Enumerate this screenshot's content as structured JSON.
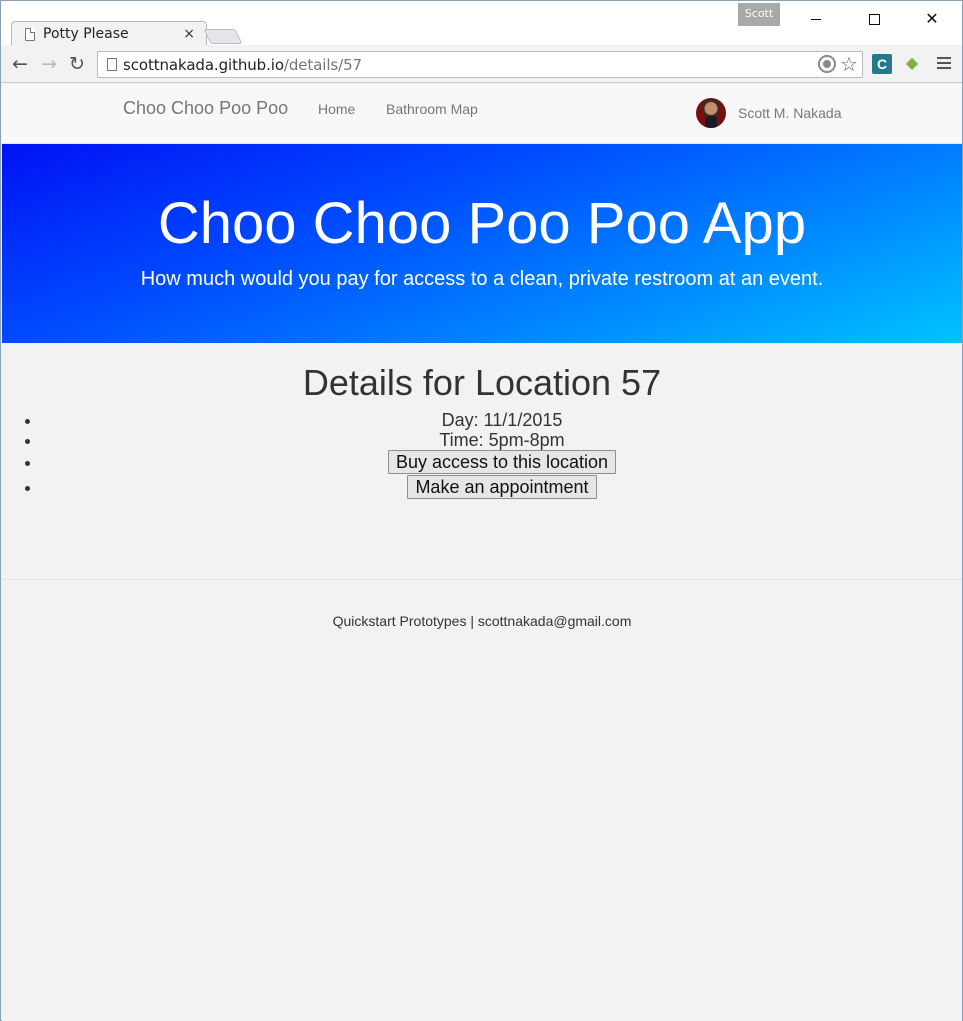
{
  "browser": {
    "tab_title": "Potty Please",
    "tab_close": "×",
    "profile_name": "Scott",
    "url_host": "scottnakada.github.io",
    "url_path": "/details/57",
    "back_icon": "←",
    "forward_icon": "→",
    "reload_icon": "↻",
    "star_icon": "☆",
    "close_icon": "✕",
    "ext1_label": "C",
    "ext2_label": "◆"
  },
  "navbar": {
    "brand": "Choo Choo Poo Poo",
    "links": [
      "Home",
      "Bathroom Map"
    ],
    "user_name": "Scott M. Nakada"
  },
  "hero": {
    "title": "Choo Choo Poo Poo App",
    "subtitle": "How much would you pay for access to a clean, private restroom at an event."
  },
  "details": {
    "title": "Details for Location 57",
    "day": "Day: 11/1/2015",
    "time": "Time: 5pm-8pm",
    "buy_button": "Buy access to this location",
    "appointment_button": "Make an appointment"
  },
  "footer": {
    "text": "Quickstart Prototypes | scottnakada@gmail.com"
  },
  "colors": {
    "hero_gradient_start": "#0012f4",
    "hero_gradient_end": "#00c4ff",
    "navbar_bg": "#f8f8f8",
    "page_bg": "#f2f2f2"
  }
}
